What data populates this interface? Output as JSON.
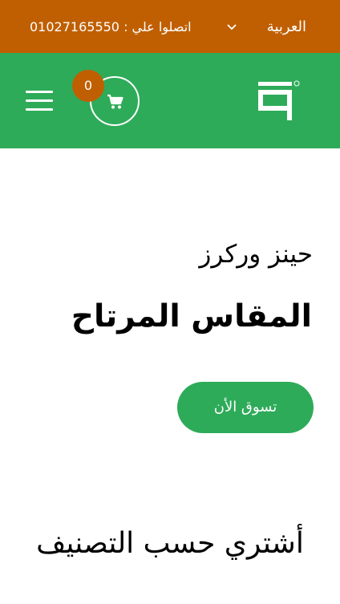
{
  "topbar": {
    "language": "العربية",
    "contact": "اتصلوا علي : 01027165550",
    "background": "#c05f02"
  },
  "header": {
    "background": "#2eab59",
    "cart_count": "0",
    "menu_icon": "hamburger-menu-icon",
    "cart_icon": "shopping-cart-icon"
  },
  "hero": {
    "subtitle": "حينز وركرز",
    "title": "المقاس المرتاح",
    "button_label": "تسوق الأن"
  },
  "categories": {
    "title": "أشتري حسب التصنيف"
  }
}
